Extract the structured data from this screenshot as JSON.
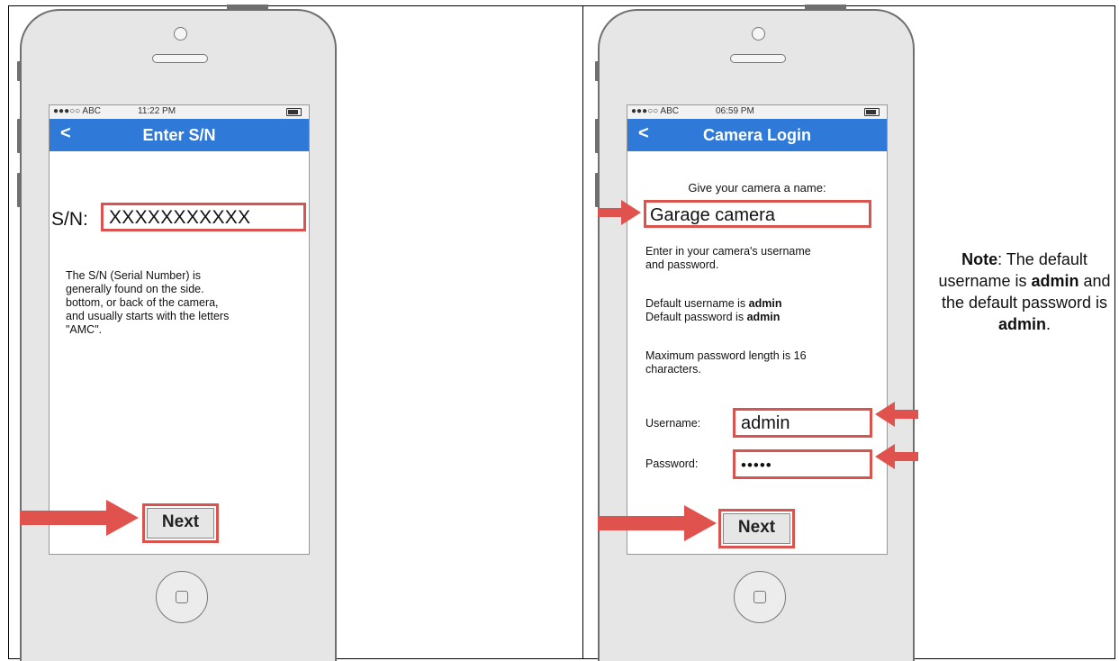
{
  "phone1": {
    "status": {
      "carrier": "●●●○○ ABC",
      "time": "11:22 PM"
    },
    "nav": {
      "back": "<",
      "title": "Enter S/N"
    },
    "sn_label": "S/N:",
    "sn_value": "XXXXXXXXXXX",
    "help_lines": [
      "The S/N (Serial Number) is",
      "generally found on the side.",
      "bottom, or back of the camera,",
      "and usually starts with the letters",
      "\"AMC\"."
    ],
    "next_label": "Next"
  },
  "phone2": {
    "status": {
      "carrier": "●●●○○ ABC",
      "time": "06:59 PM"
    },
    "nav": {
      "back": "<",
      "title": "Camera Login"
    },
    "name_prompt": "Give your camera a name:",
    "name_value": "Garage camera",
    "intro_lines": [
      "Enter in your camera's username",
      "and password."
    ],
    "default_user_prefix": "Default username is ",
    "default_user_value": "admin",
    "default_pass_prefix": "Default password is ",
    "default_pass_value": "admin",
    "maxlen_lines": [
      "Maximum password length is 16",
      "characters."
    ],
    "username_label": "Username:",
    "username_value": "admin",
    "password_label": "Password:",
    "password_value": "•••••",
    "next_label": "Next"
  },
  "note": {
    "bold1": "Note",
    "text1": ": The default username is ",
    "bold2": "admin",
    "text2": " and the default password is ",
    "bold3": "admin",
    "text3": "."
  },
  "colors": {
    "nav_blue": "#2f7ad9",
    "highlight_red": "#d9534f",
    "arrow_red": "#e0524d"
  }
}
